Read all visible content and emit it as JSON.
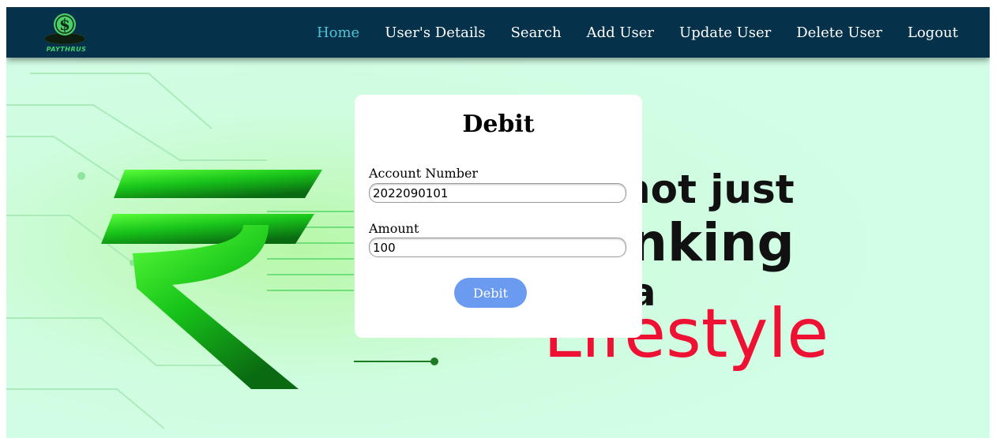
{
  "brand": {
    "logo_text": "PAYTHRUS",
    "logo_icon": "dollar-coin-icon"
  },
  "nav": {
    "items": [
      {
        "label": "Home",
        "active": true
      },
      {
        "label": "User's Details",
        "active": false
      },
      {
        "label": "Search",
        "active": false
      },
      {
        "label": "Add User",
        "active": false
      },
      {
        "label": "Update User",
        "active": false
      },
      {
        "label": "Delete User",
        "active": false
      },
      {
        "label": "Logout",
        "active": false
      }
    ]
  },
  "form": {
    "title": "Debit",
    "account_label": "Account Number",
    "account_value": "2022090101",
    "amount_label": "Amount",
    "amount_value": "100",
    "submit_label": "Debit"
  },
  "hero": {
    "line1": "not just",
    "line2": "nking",
    "line3": "a",
    "line4": "Lifestyle",
    "symbol": "rupee-symbol"
  },
  "colors": {
    "navbar": "#06314a",
    "active_link": "#4fc3d4",
    "button": "#6a9bf0",
    "lifestyle_text": "#ee1133",
    "rupee_green": "#22cc22"
  }
}
